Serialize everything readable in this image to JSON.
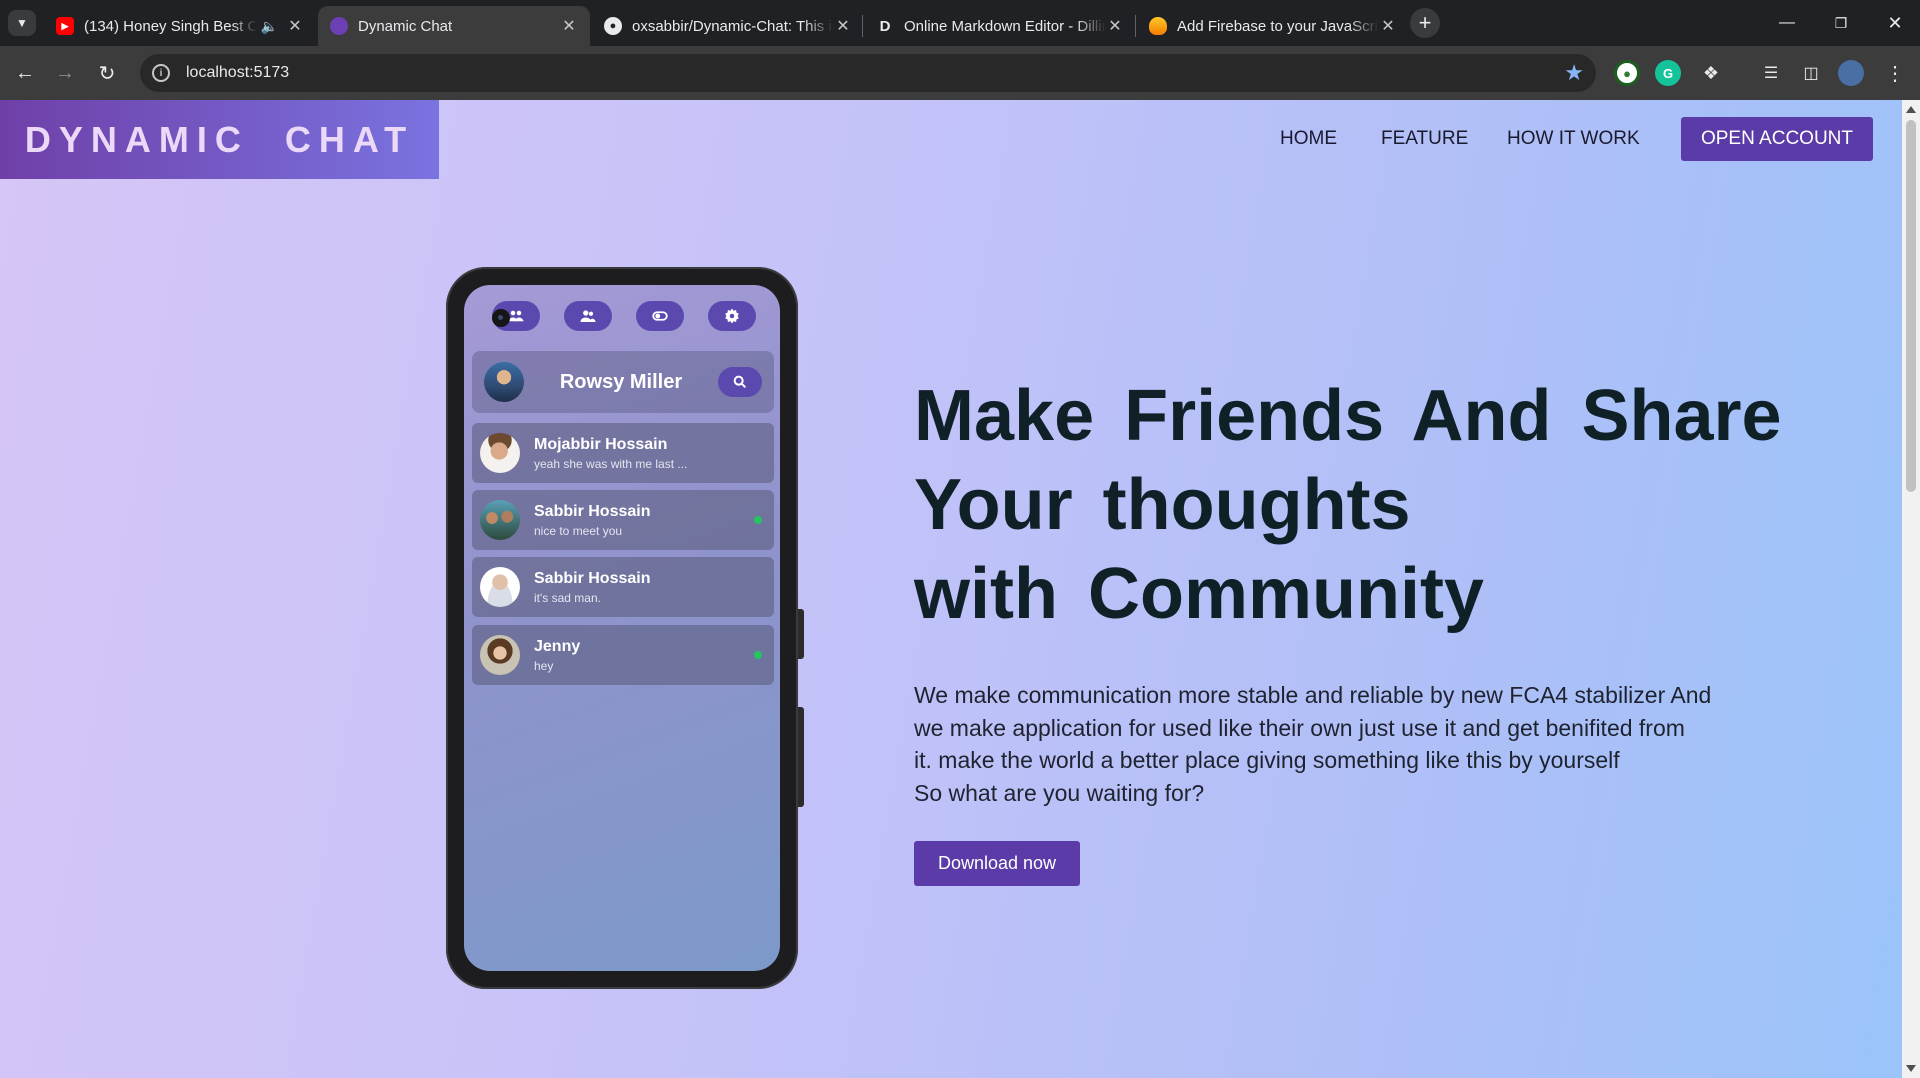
{
  "browser": {
    "tabs": [
      {
        "title": "(134) Honey Singh Best Coll",
        "active": false,
        "audio": true
      },
      {
        "title": "Dynamic Chat",
        "active": true,
        "audio": false
      },
      {
        "title": "oxsabbir/Dynamic-Chat: This is",
        "active": false,
        "audio": false
      },
      {
        "title": "Online Markdown Editor - Dillin",
        "active": false,
        "audio": false
      },
      {
        "title": "Add Firebase to your JavaScript",
        "active": false,
        "audio": false
      }
    ],
    "url": "localhost:5173"
  },
  "page": {
    "brand": "DYNAMIC  CHAT",
    "nav": {
      "home": "HOME",
      "feature": "FEATURE",
      "how": "HOW IT WORK"
    },
    "cta": "OPEN ACCOUNT",
    "headline": [
      "Make Friends And Share",
      "Your thoughts",
      "with Community"
    ],
    "description": [
      "We make communication more stable and reliable by new FCA4 stabilizer And",
      "we make application for used like their own just use it and get benifited from",
      "it. make the world a better place giving something like this by yourself",
      "So what are you waiting for?"
    ],
    "download": "Download now"
  },
  "phone": {
    "current_user": "Rowsy Miller",
    "chats": [
      {
        "name": "Mojabbir Hossain",
        "message": "yeah she was with me last ...",
        "online": false
      },
      {
        "name": "Sabbir Hossain",
        "message": "nice to meet you",
        "online": true
      },
      {
        "name": "Sabbir Hossain",
        "message": "it's sad man.",
        "online": false
      },
      {
        "name": "Jenny",
        "message": "hey",
        "online": true
      }
    ]
  },
  "colors": {
    "accent": "#5a3ba8",
    "online": "#22c55e",
    "headline": "#0f2027"
  }
}
